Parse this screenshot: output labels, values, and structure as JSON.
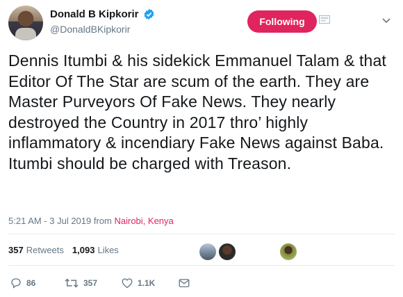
{
  "header": {
    "display_name": "Donald B Kipkorir",
    "handle": "@DonaldBKipkorir",
    "follow_label": "Following"
  },
  "tweet": {
    "text": "Dennis Itumbi & his sidekick Emmanuel Talam & that Editor Of The Star are scum of the earth. They are Master Purveyors Of Fake News. They nearly destroyed the Country in 2017 thro’ highly inflammatory & incendiary Fake News against Baba. Itumbi should be charged with Treason."
  },
  "meta": {
    "time": "5:21 AM - 3 Jul 2019 from",
    "location": "Nairobi, Kenya"
  },
  "stats": {
    "retweets_count": "357",
    "retweets_label": "Retweets",
    "likes_count": "1,093",
    "likes_label": "Likes"
  },
  "actions": {
    "reply_count": "86",
    "retweet_count": "357",
    "like_count": "1.1K"
  },
  "colors": {
    "accent": "#e0245e",
    "verified": "#1da1f2",
    "secondary_text": "#657786"
  }
}
